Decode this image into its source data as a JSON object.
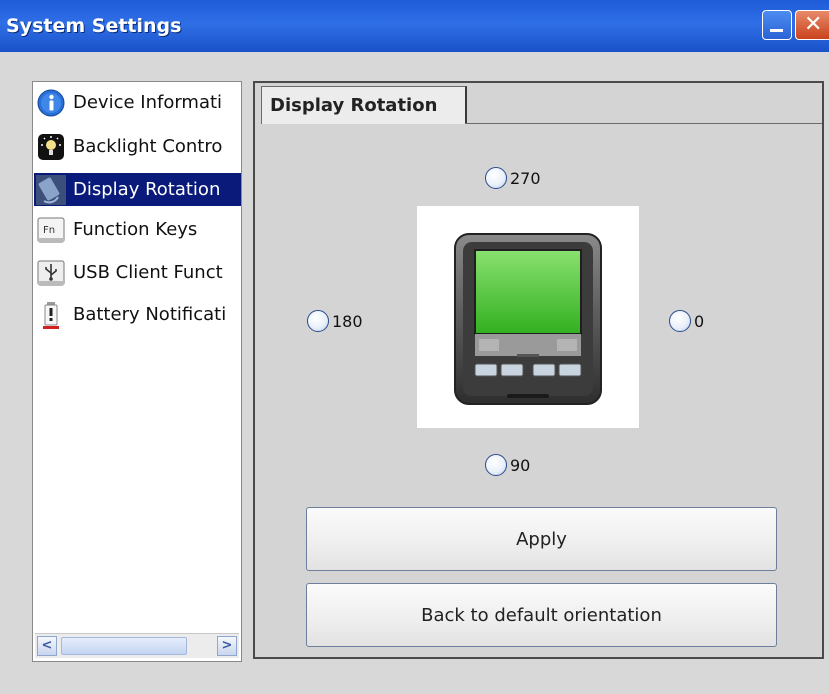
{
  "window": {
    "title": "System Settings"
  },
  "nav": {
    "items": [
      {
        "label": "Device Informati",
        "icon": "info-icon"
      },
      {
        "label": "Backlight Contro",
        "icon": "backlight-icon"
      },
      {
        "label": "Display Rotation",
        "icon": "rotation-icon",
        "selected": true
      },
      {
        "label": "Function Keys",
        "icon": "function-key-icon"
      },
      {
        "label": "USB Client Funct",
        "icon": "usb-icon"
      },
      {
        "label": "Battery Notificati",
        "icon": "battery-icon"
      }
    ],
    "scroll_left": "<",
    "scroll_right": ">"
  },
  "tab": {
    "label": "Display Rotation"
  },
  "rotation": {
    "options": {
      "r270": "270",
      "r180": "180",
      "r0": "0",
      "r90": "90"
    },
    "device_icon": "handheld-device-icon"
  },
  "buttons": {
    "apply": "Apply",
    "default": "Back to default orientation"
  },
  "colors": {
    "titlebar": "#1e5bd8",
    "selection": "#0a1a7a",
    "screen_green": "#5ccc3c"
  }
}
